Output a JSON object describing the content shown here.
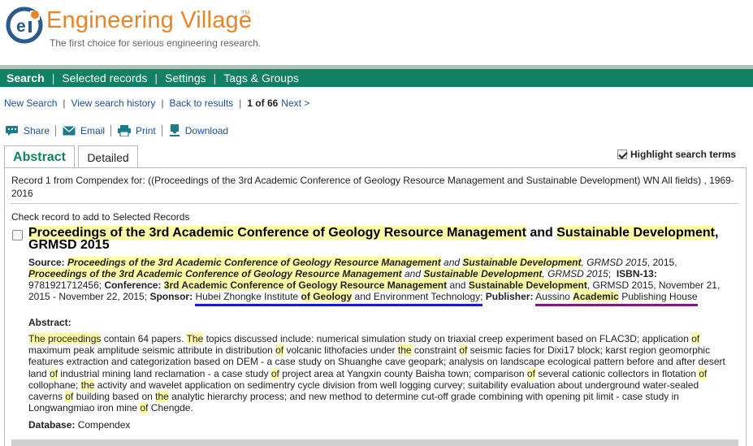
{
  "header": {
    "logo_title": "Engineering Village",
    "logo_tm": "TM",
    "tagline": "The first choice for serious engineering research."
  },
  "navbar": {
    "items": [
      {
        "label": "Search",
        "active": true
      },
      {
        "label": "Selected records",
        "active": false
      },
      {
        "label": "Settings",
        "active": false
      },
      {
        "label": "Tags & Groups",
        "active": false
      }
    ],
    "separator": "|"
  },
  "subnav": {
    "new_search": "New Search",
    "view_history": "View search history",
    "back_to_results": "Back to results",
    "position": "1 of 66",
    "next": "Next >"
  },
  "actions": {
    "share": "Share",
    "email": "Email",
    "print": "Print",
    "download": "Download"
  },
  "tabs": {
    "abstract": "Abstract",
    "detailed": "Detailed"
  },
  "highlight_toggle": {
    "label": "Highlight search terms",
    "checked": true
  },
  "record": {
    "summary": "Record 1 from Compendex for: ((Proceedings of the 3rd Academic Conference of Geology Resource Management and Sustainable Development) WN All fields) , 1969-2016",
    "check_label": "Check record to add to Selected Records",
    "title_part1": "Proceedings of the 3rd Academic Conference of Geology Resource Management",
    "title_and": " and ",
    "title_part2": "Sustainable Development",
    "title_part3": ", GRMSD 2015",
    "source_label": "Source:",
    "source_part1": "Proceedings of the 3rd Academic Conference of Geology Resource Management",
    "source_and1": " and ",
    "source_part2": "Sustainable Development",
    "source_part3": ", GRMSD 2015",
    "source_part4": ", 2015, ",
    "source_part5": "Proceedings of the 3rd Academic Conference of Geology Resource Management",
    "source_and2": " and ",
    "source_part6": "Sustainable Development",
    "source_part7": ", GRMSD 2015",
    "source_part8": ";",
    "isbn_label": "ISBN-13:",
    "isbn_value": "9781921712456;",
    "conference_label": "Conference:",
    "conference_part1": "3rd Academic Conference of Geology Resource Management",
    "conference_and": " and ",
    "conference_part2": "Sustainable Development",
    "conference_rest": ", GRMSD 2015, November 21, 2015 - November 22, 2015;",
    "sponsor_label": "Sponsor:",
    "sponsor_part1": "Hubei Zhongke Institute ",
    "sponsor_part2": "of Geology",
    "sponsor_part3": " and Environment Technology;",
    "publisher_label": "Publisher:",
    "publisher_part1": "Aussino ",
    "publisher_part2": "Academic",
    "publisher_part3": " Publishing House",
    "abstract_heading": "Abstract:",
    "abstract": [
      {
        "t": "The proceedings",
        "h": true
      },
      {
        "t": " contain 64 papers. ",
        "h": false
      },
      {
        "t": "The",
        "h": true
      },
      {
        "t": " topics discussed include: numerical simulation study on triaxial creep experiment based on FLAC3D; application ",
        "h": false
      },
      {
        "t": "of",
        "h": true
      },
      {
        "t": " maximum peak amplitude seismic attribute in distribution ",
        "h": false
      },
      {
        "t": "of",
        "h": true
      },
      {
        "t": " volcanic lithofacies under ",
        "h": false
      },
      {
        "t": "the",
        "h": true
      },
      {
        "t": " constraint ",
        "h": false
      },
      {
        "t": "of",
        "h": true
      },
      {
        "t": " seismic facies for Dixi17 block; karst region geomorphic features extraction and categorization based on DEM - a case study on Shuanghe cave geopark; analysis on landscape ecological pattern before and after desert land ",
        "h": false
      },
      {
        "t": "of",
        "h": true
      },
      {
        "t": " industrial mining land reclamation - a case study ",
        "h": false
      },
      {
        "t": "of",
        "h": true
      },
      {
        "t": " project area at Yangxin county Baisha town; comparison ",
        "h": false
      },
      {
        "t": "of",
        "h": true
      },
      {
        "t": " several cationic collectors in flotation ",
        "h": false
      },
      {
        "t": "of",
        "h": true
      },
      {
        "t": " collophane; ",
        "h": false
      },
      {
        "t": "the",
        "h": true
      },
      {
        "t": " activity and wavelet application on sedimentry cycle division from well logging curvey; suitability evaluation about underground water-sealed caverns ",
        "h": false
      },
      {
        "t": "of",
        "h": true
      },
      {
        "t": " building based on ",
        "h": false
      },
      {
        "t": "the",
        "h": true
      },
      {
        "t": " analytic hierarchy process; and new method to determine cut-off grade combining with opening pit limit - case study in Longwangmiao iron mine ",
        "h": false
      },
      {
        "t": "of",
        "h": true
      },
      {
        "t": " Chengde.",
        "h": false
      }
    ],
    "database_label": "Database:",
    "database_value": "Compendex"
  },
  "colors": {
    "brand_orange": "#e8842a",
    "nav_green": "#138064",
    "link_blue": "#1a4e9a",
    "highlight_yellow": "#fefba6",
    "sponsor_underline": "#1020d0",
    "publisher_underline": "#7d1a7d"
  },
  "icons": [
    "engineering-village-logo",
    "share-icon",
    "email-icon",
    "print-icon",
    "download-icon"
  ]
}
